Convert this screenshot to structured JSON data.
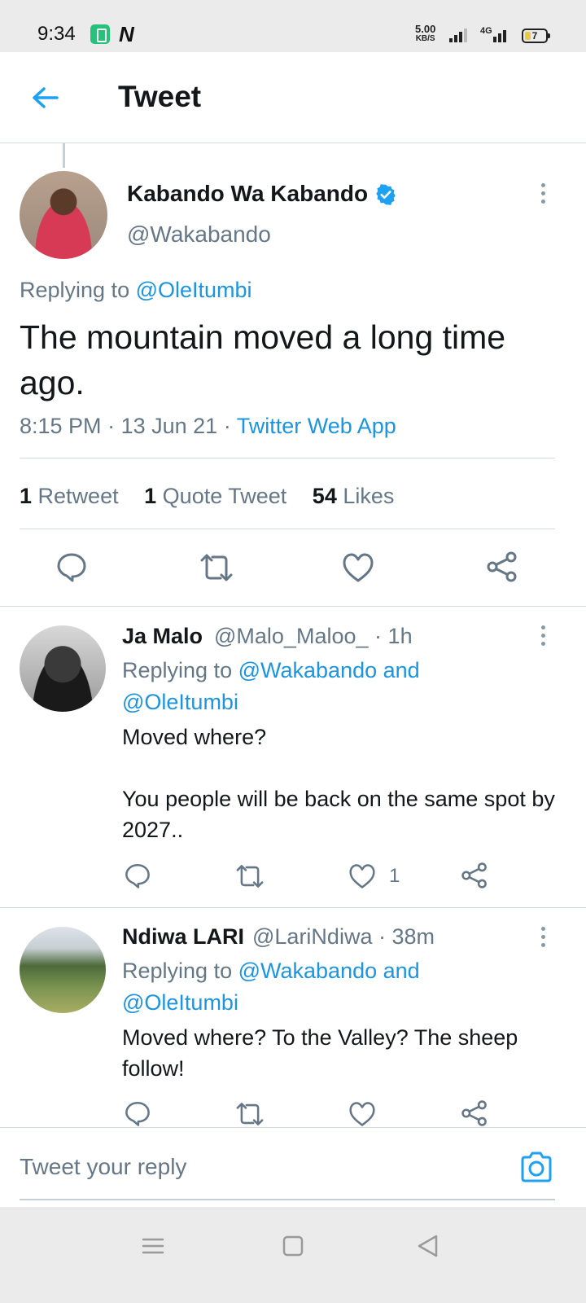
{
  "status_bar": {
    "time": "9:34",
    "net_speed": "5.00",
    "net_unit": "KB/S",
    "network_type": "4G",
    "battery": "7",
    "icons": [
      "battery-saver-app-icon",
      "n-app-icon",
      "signal-icon",
      "battery-icon"
    ]
  },
  "header": {
    "title": "Tweet",
    "back_icon": "arrow-left-icon"
  },
  "main_tweet": {
    "author_name": "Kabando Wa Kabando",
    "handle": "@Wakabando",
    "verified": true,
    "replying_prefix": "Replying to",
    "replying_to": "@OleItumbi",
    "text": "The mountain moved a long time ago.",
    "time": "8:15 PM",
    "date": "13 Jun 21",
    "source": "Twitter Web App",
    "separator": "·",
    "stats": {
      "retweets_count": "1",
      "retweets_label": "Retweet",
      "quotes_count": "1",
      "quotes_label": "Quote Tweet",
      "likes_count": "54",
      "likes_label": "Likes"
    }
  },
  "replies": [
    {
      "name": "Ja Malo",
      "handle": "@Malo_Maloo_",
      "time": "1h",
      "replying_prefix": "Replying to",
      "replying_to_line1": "@Wakabando and",
      "replying_to_line2": "@OleItumbi",
      "text_line1": "Moved where?",
      "text_line2": "You people will be back on the same spot by 2027..",
      "like_count": "1"
    },
    {
      "name": "Ndiwa LARI",
      "handle": "@LariNdiwa",
      "time": "38m",
      "replying_prefix": "Replying to",
      "replying_to_line1": "@Wakabando and",
      "replying_to_line2": "@OleItumbi",
      "text": "Moved where? To the Valley? The sheep follow!",
      "like_count": ""
    }
  ],
  "reply_bar": {
    "placeholder": "Tweet your reply",
    "camera_icon": "camera-icon"
  },
  "colors": {
    "accent": "#1da1f2",
    "link": "#1b95e0",
    "secondary_text": "#657786",
    "divider": "#d6dbe0"
  }
}
